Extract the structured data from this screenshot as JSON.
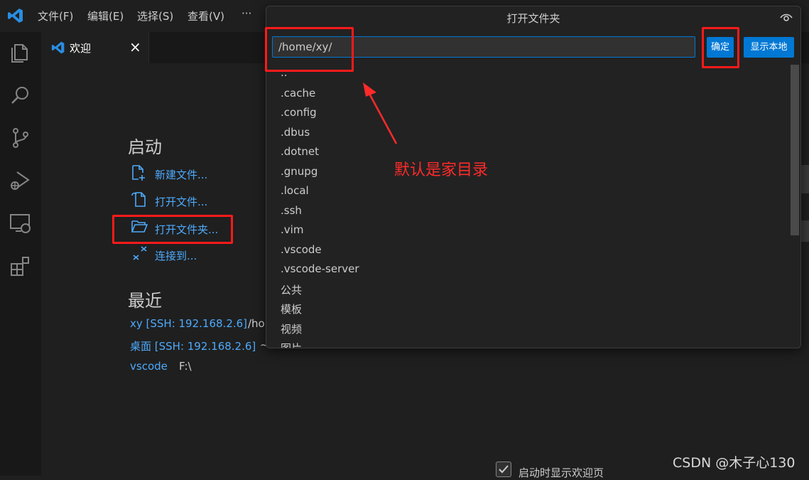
{
  "menubar": {
    "items": [
      "文件(F)",
      "编辑(E)",
      "选择(S)",
      "查看(V)",
      "···"
    ]
  },
  "tabs": [
    {
      "label": "欢迎",
      "close": "×"
    }
  ],
  "welcome": {
    "start_heading": "启动",
    "start_items": [
      "新建文件...",
      "打开文件...",
      "打开文件夹...",
      "连接到..."
    ],
    "recent_heading": "最近",
    "recent_items": [
      {
        "name": "xy [SSH: 192.168.2.6]",
        "path": "/ho"
      },
      {
        "name": "桌面 [SSH: 192.168.2.6]",
        "path": "~"
      },
      {
        "name": "vscode",
        "path": "F:\\"
      }
    ],
    "show_on_startup": "启动时显示欢迎页"
  },
  "dialog": {
    "title": "打开文件夹",
    "path_value": "/home/xy/",
    "ok_label": "确定",
    "show_local_label": "显示本地",
    "files": [
      "..",
      ".cache",
      ".config",
      ".dbus",
      ".dotnet",
      ".gnupg",
      ".local",
      ".ssh",
      ".vim",
      ".vscode",
      ".vscode-server",
      "公共",
      "模板",
      "视频",
      "图片"
    ]
  },
  "annotation": {
    "text": "默认是家目录",
    "color": "#ff2a2a"
  },
  "watermark": "CSDN @木子心130",
  "colors": {
    "accent": "#0078d4",
    "link": "#4daafc",
    "highlight": "#ff1a1a"
  }
}
